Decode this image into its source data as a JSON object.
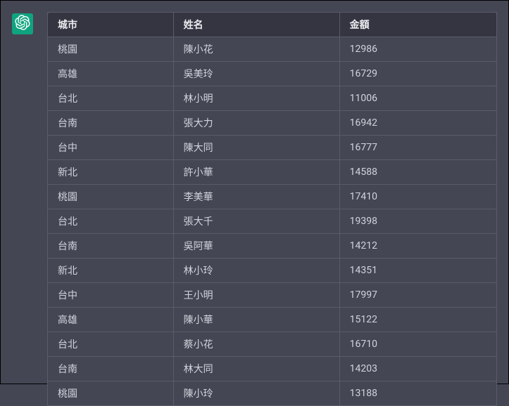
{
  "table": {
    "headers": {
      "city": "城市",
      "name": "姓名",
      "amount": "金額"
    },
    "rows": [
      {
        "city": "桃園",
        "name": "陳小花",
        "amount": "12986"
      },
      {
        "city": "高雄",
        "name": "吳美玲",
        "amount": "16729"
      },
      {
        "city": "台北",
        "name": "林小明",
        "amount": "11006"
      },
      {
        "city": "台南",
        "name": "張大力",
        "amount": "16942"
      },
      {
        "city": "台中",
        "name": "陳大同",
        "amount": "16777"
      },
      {
        "city": "新北",
        "name": "許小華",
        "amount": "14588"
      },
      {
        "city": "桃園",
        "name": "李美華",
        "amount": "17410"
      },
      {
        "city": "台北",
        "name": "張大千",
        "amount": "19398"
      },
      {
        "city": "台南",
        "name": "吳阿華",
        "amount": "14212"
      },
      {
        "city": "新北",
        "name": "林小玲",
        "amount": "14351"
      },
      {
        "city": "台中",
        "name": "王小明",
        "amount": "17997"
      },
      {
        "city": "高雄",
        "name": "陳小華",
        "amount": "15122"
      },
      {
        "city": "台北",
        "name": "蔡小花",
        "amount": "16710"
      },
      {
        "city": "台南",
        "name": "林大同",
        "amount": "14203"
      },
      {
        "city": "桃園",
        "name": "陳小玲",
        "amount": "13188"
      }
    ]
  }
}
